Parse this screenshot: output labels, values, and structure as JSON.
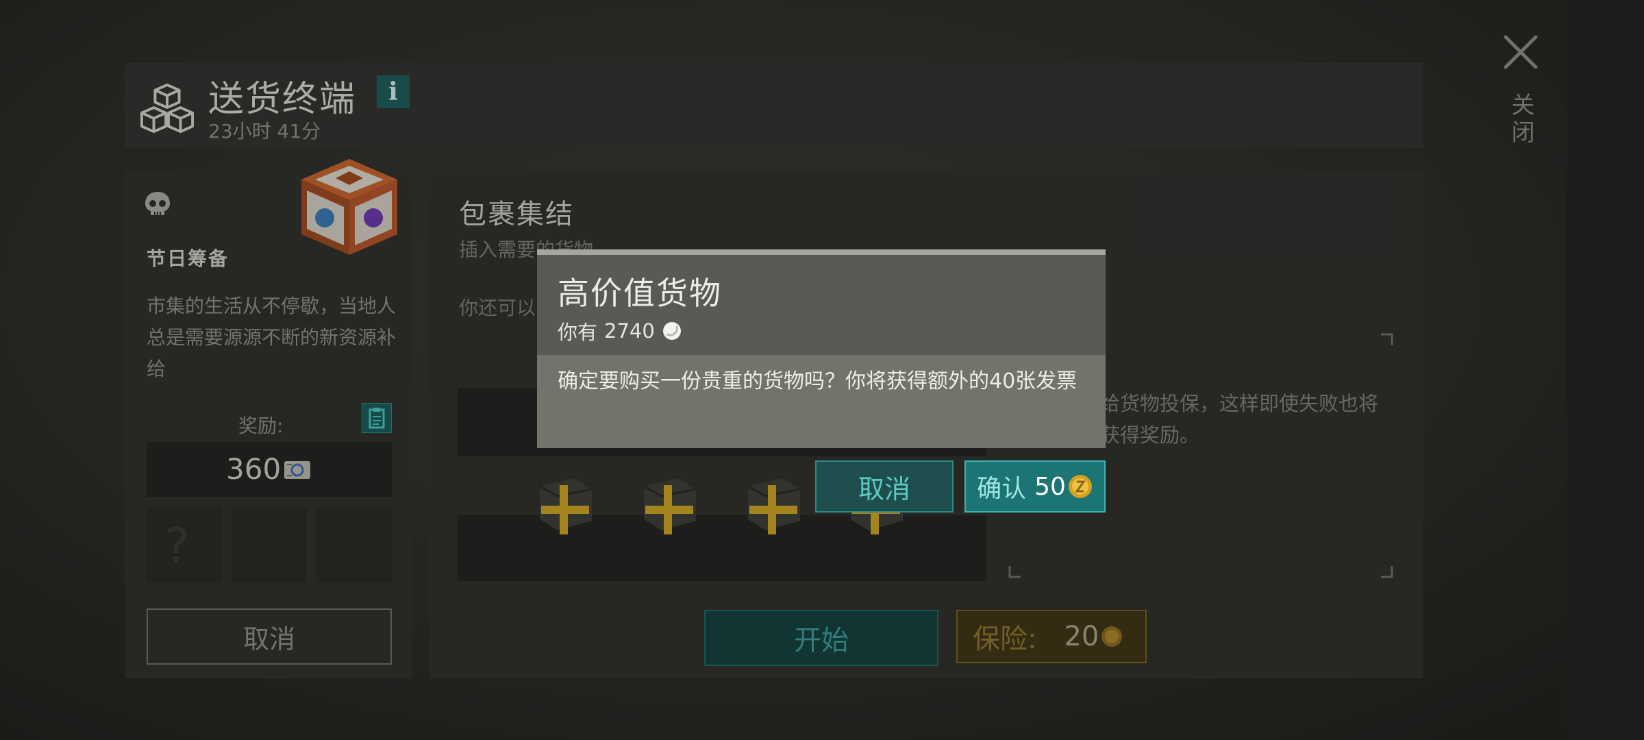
{
  "header": {
    "title": "送货终端",
    "timer": "23小时 41分",
    "info_label": "i",
    "close_label": "关闭"
  },
  "quest": {
    "name": "节日筹备",
    "description": "市集的生活从不停歇，当地人总是需要源源不断的新资源补给",
    "reward_label": "奖励:",
    "reward_value": "360",
    "unknown_slot": "?",
    "cancel_label": "取消"
  },
  "main": {
    "title": "包裹集结",
    "subtitle": "插入需要的货物",
    "line2": "你还可以",
    "insure_text": "给货物投保，这样即使失败也将获得奖励。",
    "start_label": "开始",
    "insure_label": "保险:",
    "insure_cost": "20"
  },
  "modal": {
    "title": "高价值货物",
    "have_label": "你有",
    "have_value": "2740",
    "message": "确定要购买一份贵重的货物吗？你将获得额外的40张发票",
    "cancel_label": "取消",
    "confirm_label": "确认",
    "confirm_cost": "50"
  },
  "colors": {
    "accent_teal": "#1d7474",
    "gold": "#d4a020",
    "plus_gold": "#c9a227"
  },
  "icons": [
    "boxes-icon",
    "info-icon",
    "close-icon",
    "skull-icon",
    "crate-image",
    "clipboard-icon",
    "ticket-icon",
    "plus-icon",
    "coin-icon",
    "pearl-icon"
  ]
}
